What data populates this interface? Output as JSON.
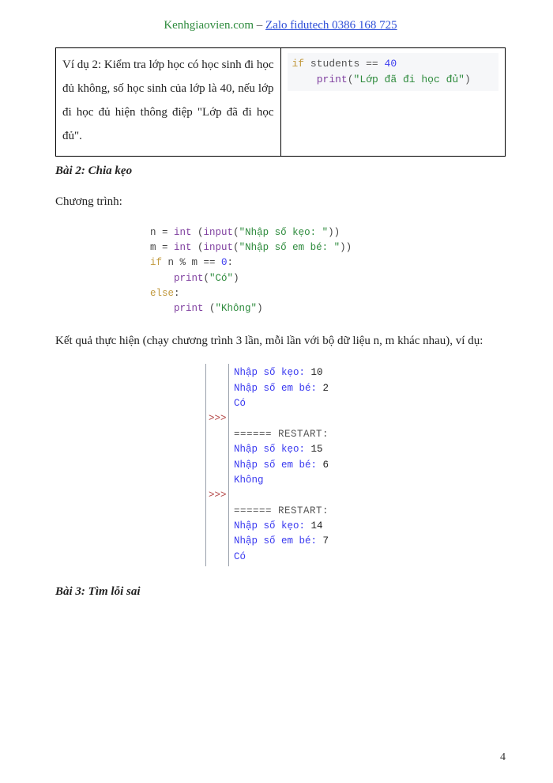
{
  "header": {
    "site": "Kenhgiaovien.com",
    "sep": " – ",
    "zalo": "Zalo fidutech 0386 168 725"
  },
  "example": {
    "left_text": "Ví dụ 2: Kiểm tra lớp học có học sinh đi học đủ không, số học sinh của lớp là 40, nếu lớp đi học đủ hiện thông điệp \"Lớp đã đi học đủ\".",
    "code": {
      "l1_kw": "if",
      "l1_var": " students ",
      "l1_op": "==",
      "l1_num": " 40",
      "l2_indent": "    ",
      "l2_fn": "print",
      "l2_paren_o": "(",
      "l2_str": "\"Lớp đã đi học đủ\"",
      "l2_paren_c": ")"
    }
  },
  "section2": {
    "title": "Bài 2: Chia kẹo",
    "para": "Chương trình:",
    "code": {
      "l1": {
        "a": "n = ",
        "fn": "int",
        "b": " (",
        "fn2": "input",
        "c": "(",
        "s": "\"Nhập số kẹo: \"",
        "d": "))"
      },
      "l2": {
        "a": "m = ",
        "fn": "int",
        "b": " (",
        "fn2": "input",
        "c": "(",
        "s": "\"Nhập số em bé: \"",
        "d": "))"
      },
      "l3": {
        "kw": "if",
        "a": " n % m == ",
        "n": "0",
        "b": ":"
      },
      "l4": {
        "indent": "    ",
        "fn": "print",
        "a": "(",
        "s": "\"Có\"",
        "b": ")"
      },
      "l5": {
        "kw": "else",
        "a": ":"
      },
      "l6": {
        "indent": "    ",
        "fn": "print",
        "a": " (",
        "s": "\"Không\"",
        "b": ")"
      }
    },
    "result_para": "Kết quả thực hiện (chạy chương trình 3 lần, mỗi lần với bộ dữ liệu n, m khác nhau), ví dụ:",
    "output": {
      "prompt": ">>>",
      "r1_l1_lbl": "Nhập số kẹo: ",
      "r1_l1_val": "10",
      "r1_l2_lbl": "Nhập số em bé: ",
      "r1_l2_val": "2",
      "r1_res": "Có",
      "restart": "====== RESTART:",
      "r2_l1_lbl": "Nhập số kẹo: ",
      "r2_l1_val": "15",
      "r2_l2_lbl": "Nhập số em bé: ",
      "r2_l2_val": "6",
      "r2_res": "Không",
      "r3_l1_lbl": "Nhập số kẹo: ",
      "r3_l1_val": "14",
      "r3_l2_lbl": "Nhập số em bé: ",
      "r3_l2_val": "7",
      "r3_res": "Có"
    }
  },
  "section3": {
    "title": "Bài 3: Tìm lỗi sai"
  },
  "page_num": "4"
}
